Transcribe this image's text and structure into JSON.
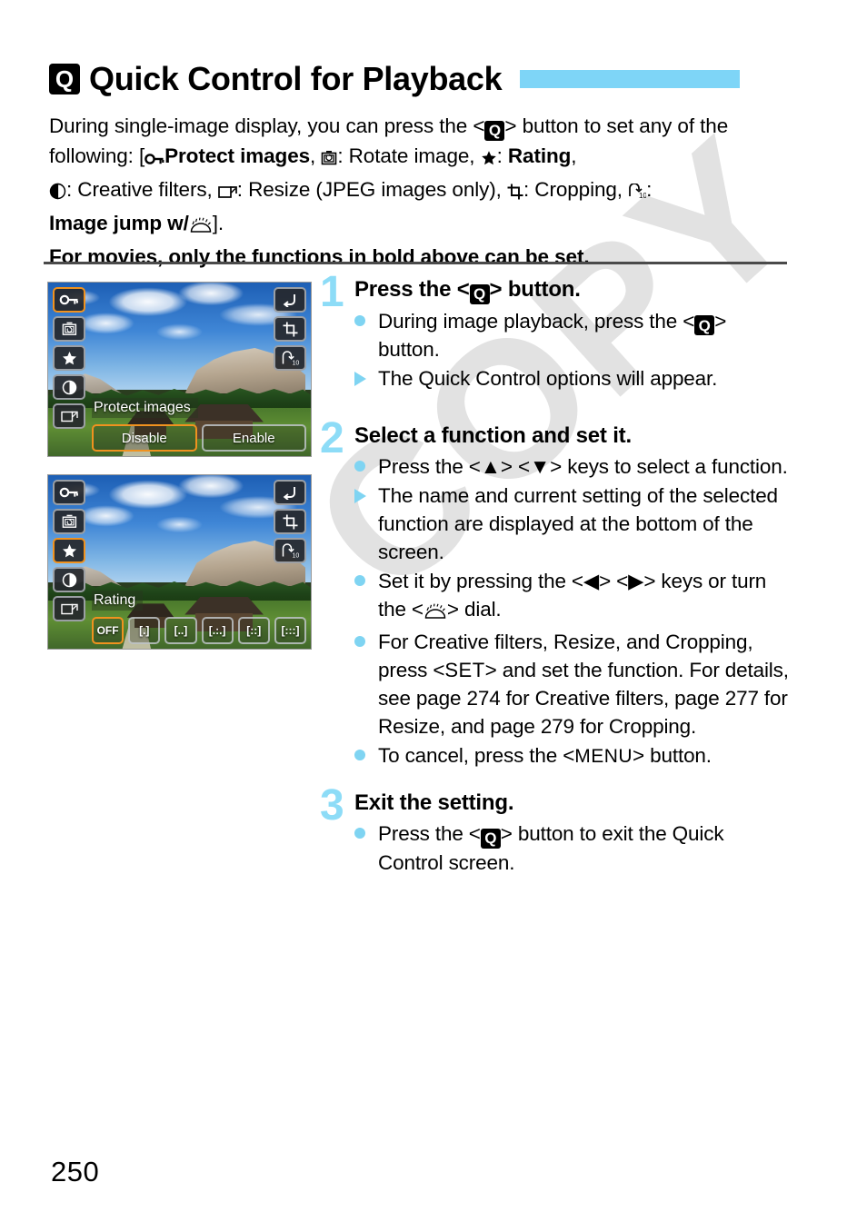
{
  "header": {
    "icon": "q-button-icon",
    "title": "Quick Control for Playback",
    "accent_color": "#7ed5f7"
  },
  "intro": {
    "line1_a": "During single-image display, you can press the <",
    "line1_q": "Q",
    "line1_b": "> button to set any of the following: [",
    "item1_icon": "protect-key-icon",
    "item1_label": "Protect images",
    "item2_icon": "rotate-image-icon",
    "item2_label": "Rotate image",
    "item3_icon": "star-rating-icon",
    "item3_label": "Rating",
    "item4_icon": "creative-filters-icon",
    "item4_label": "Creative filters",
    "item5_icon": "resize-icon",
    "item5_label": "Resize (JPEG images only)",
    "item6_icon": "cropping-icon",
    "item6_label": "Cropping",
    "item7_icon": "image-jump-icon",
    "item7_label": "Image jump w/",
    "item7_dial_icon": "main-dial-icon",
    "closing": "].",
    "movies_note": "For movies, only the functions in bold above can be set."
  },
  "screens": [
    {
      "name": "protect-images-screen",
      "left_icons": [
        {
          "name": "protect-key-icon",
          "selected": true
        },
        {
          "name": "rotate-image-icon",
          "selected": false
        },
        {
          "name": "star-rating-icon",
          "selected": false
        },
        {
          "name": "creative-filters-icon",
          "selected": false
        },
        {
          "name": "resize-icon",
          "selected": false
        }
      ],
      "right_icons": [
        {
          "name": "return-arrow-icon"
        },
        {
          "name": "cropping-icon"
        },
        {
          "name": "image-jump-icon"
        }
      ],
      "function_label": "Protect images",
      "options": [
        {
          "label": "Disable",
          "selected": true
        },
        {
          "label": "Enable",
          "selected": false
        }
      ]
    },
    {
      "name": "rating-screen",
      "left_icons": [
        {
          "name": "protect-key-icon",
          "selected": false
        },
        {
          "name": "rotate-image-icon",
          "selected": false
        },
        {
          "name": "star-rating-icon",
          "selected": true
        },
        {
          "name": "creative-filters-icon",
          "selected": false
        },
        {
          "name": "resize-icon",
          "selected": false
        }
      ],
      "right_icons": [
        {
          "name": "return-arrow-icon"
        },
        {
          "name": "cropping-icon"
        },
        {
          "name": "image-jump-icon"
        }
      ],
      "function_label": "Rating",
      "options": [
        {
          "label": "OFF",
          "selected": true
        },
        {
          "label": "[.]",
          "selected": false
        },
        {
          "label": "[..]",
          "selected": false
        },
        {
          "label": "[.:.]",
          "selected": false
        },
        {
          "label": "[::]",
          "selected": false
        },
        {
          "label": "[:::]",
          "selected": false
        }
      ]
    }
  ],
  "steps": [
    {
      "number": "1",
      "heading_a": "Press the <",
      "heading_q": "Q",
      "heading_b": "> button.",
      "bullets": [
        {
          "marker": "dot",
          "text_a": "During image playback, press the <",
          "q": "Q",
          "text_b": "> button."
        },
        {
          "marker": "tri",
          "text_a": "The Quick Control options will appear.",
          "q": "",
          "text_b": ""
        }
      ]
    },
    {
      "number": "2",
      "heading_a": "Select a function and set it.",
      "heading_q": "",
      "heading_b": "",
      "bullets": [
        {
          "marker": "dot",
          "text_a": "Press the <▲> <▼> keys to select a function.",
          "q": "",
          "text_b": ""
        },
        {
          "marker": "tri",
          "text_a": "The name and current setting of the selected function are displayed at the bottom of the screen.",
          "q": "",
          "text_b": ""
        },
        {
          "marker": "dot",
          "text_a": "Set it by pressing the <◀> <▶> keys or turn the <dial> dial.",
          "q": "",
          "text_b": ""
        },
        {
          "marker": "dot",
          "text_a": "For Creative filters, Resize, and Cropping, press <SET> and set the function. For details, see page 274 for Creative filters, page 277 for Resize, and page 279 for Cropping.",
          "q": "",
          "text_b": ""
        },
        {
          "marker": "dot",
          "text_a": "To cancel, press the <MENU> button.",
          "q": "",
          "text_b": ""
        }
      ]
    },
    {
      "number": "3",
      "heading_a": "Exit the setting.",
      "heading_q": "",
      "heading_b": "",
      "bullets": [
        {
          "marker": "dot",
          "text_a": "Press the <",
          "q": "Q",
          "text_b": "> button to exit the Quick Control screen."
        }
      ]
    }
  ],
  "watermark": "COPY",
  "page_number": "250"
}
